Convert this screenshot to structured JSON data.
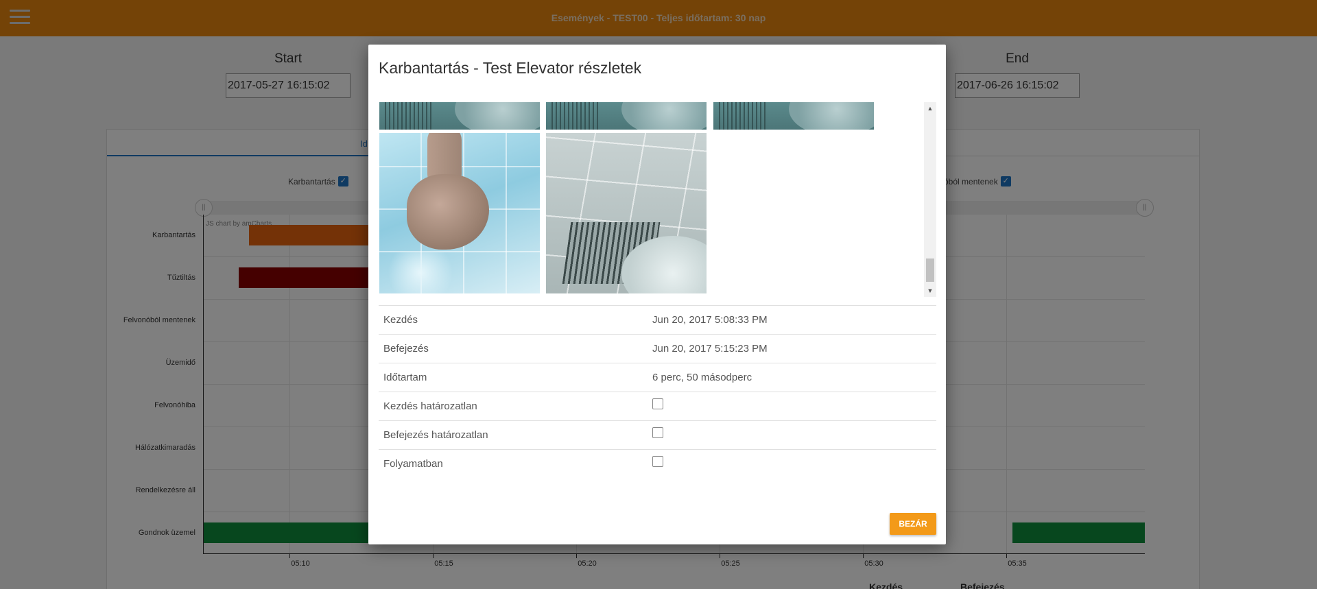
{
  "header": {
    "title": "Események - TEST00 - Teljes időtartam: 30 nap",
    "menu_icon": "hamburger-menu-icon"
  },
  "range": {
    "start_label": "Start",
    "start_value": "2017-05-27 16:15:02",
    "end_label": "End",
    "end_value": "2017-06-26 16:15:02"
  },
  "tabs": {
    "active_label": "Id"
  },
  "legend": {
    "left_label": "Karbantartás",
    "right_label": "óból mentenek"
  },
  "chart": {
    "credit": "JS chart by amCharts",
    "categories": [
      "Karbantartás",
      "Tűztiltás",
      "Felvonóból mentenek",
      "Üzemidő",
      "Felvonóhiba",
      "Hálózatkimaradás",
      "Rendelkezésre áll",
      "Gondnok üzemel"
    ],
    "x_ticks": [
      "05:10",
      "05:15",
      "05:20",
      "05:25",
      "05:30",
      "05:35"
    ],
    "colors": {
      "karbantartas": "#e8650f",
      "tuztiltas": "#8b0000",
      "gondnok": "#0f8f3c"
    }
  },
  "bottom": {
    "start_head": "Kezdés",
    "end_head": "Befejezés"
  },
  "modal": {
    "title": "Karbantartás - Test Elevator részletek",
    "details": [
      {
        "label": "Kezdés",
        "value": "Jun 20, 2017 5:08:33 PM"
      },
      {
        "label": "Befejezés",
        "value": "Jun 20, 2017 5:15:23 PM"
      },
      {
        "label": "Időtartam",
        "value": "6 perc, 50 másodperc"
      },
      {
        "label": "Kezdés határozatlan",
        "checked": false
      },
      {
        "label": "Befejezés határozatlan",
        "checked": false
      },
      {
        "label": "Folyamatban",
        "checked": false
      }
    ],
    "close_label": "BEZÁR"
  }
}
